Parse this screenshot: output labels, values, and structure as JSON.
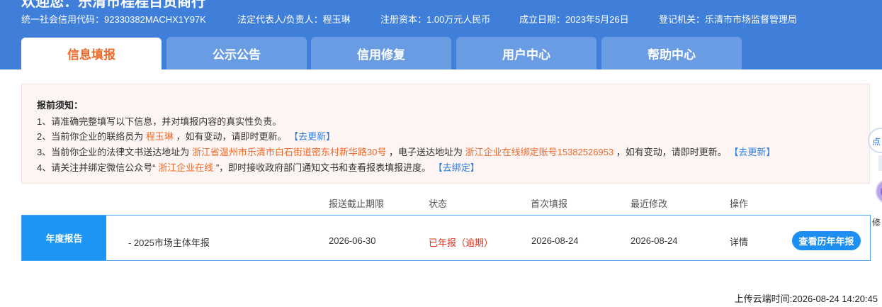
{
  "header": {
    "welcome": "欢迎您：乐清市程程百货商行",
    "credit_code": "统一社会信用代码：92330382MACHX1Y97K",
    "legal_rep": "法定代表人/负责人：程玉琳",
    "capital": "注册资本：1.00万元人民币",
    "founded": "成立日期：2023年5月26日",
    "authority": "登记机关：乐清市市场监督管理局"
  },
  "tabs": [
    {
      "label": "信息填报",
      "active": true
    },
    {
      "label": "公示公告",
      "active": false
    },
    {
      "label": "信用修复",
      "active": false
    },
    {
      "label": "用户中心",
      "active": false
    },
    {
      "label": "帮助中心",
      "active": false
    }
  ],
  "notice": {
    "title": "报前须知：",
    "line1": "1、请准确完整填写以下信息，并对填报内容的真实性负责。",
    "line2_pre": "2、当前你企业的联络员为",
    "line2_name": "程玉琳",
    "line2_post": "，如有变动，请即时更新。",
    "line2_link": "【去更新】",
    "line3_pre": "3、当前你企业的法律文书送达地址为",
    "line3_addr": "浙江省温州市乐清市白石街道密东村新华路30号",
    "line3_mid": "，电子送达地址为",
    "line3_eaddr": "浙江企业在线绑定账号15382526953",
    "line3_post": "，如有变动，请即时更新。",
    "line3_link": "【去更新】",
    "line4_pre": "4、请关注并绑定微信公众号“",
    "line4_name": "浙江企业在线",
    "line4_post": "”，即时接收政府部门通知文书和查看报表填报进度。",
    "line4_link": "【去绑定】"
  },
  "table": {
    "headers": [
      "报送截止期限",
      "状态",
      "首次填报",
      "最近修改",
      "操作"
    ],
    "section_label": "年度报告",
    "row": {
      "name": "- 2025市场主体年报",
      "deadline": "2026-06-30",
      "status": "已年报（逾期）",
      "first_filed": "2026-08-24",
      "last_modified": "2026-08-24",
      "action": "详情",
      "history_button": "查看历年年报"
    }
  },
  "upload_time": "上传云端时间:2026-08-24 14:20:45",
  "float": {
    "top_text": "点",
    "bottom_text": "修"
  },
  "colors": {
    "header_bg": "#3f7fda",
    "active_tab_text": "#ee6a2a",
    "highlight": "#ee6a2a",
    "link": "#2b7de0",
    "status_overdue": "#e0321e",
    "section_label_bg": "#1d96f3"
  }
}
